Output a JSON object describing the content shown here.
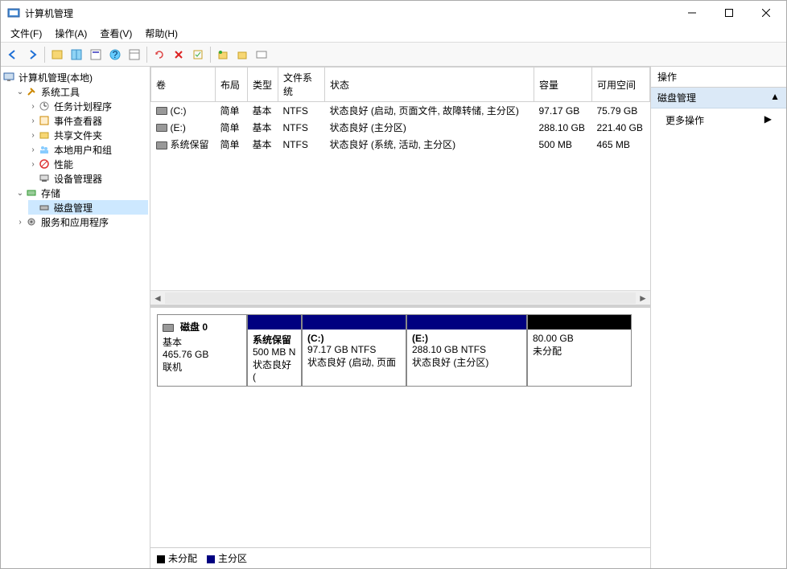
{
  "window": {
    "title": "计算机管理"
  },
  "menus": {
    "file": "文件(F)",
    "action": "操作(A)",
    "view": "查看(V)",
    "help": "帮助(H)"
  },
  "tree": {
    "root": "计算机管理(本地)",
    "system_tools": "系统工具",
    "task_scheduler": "任务计划程序",
    "event_viewer": "事件查看器",
    "shared_folders": "共享文件夹",
    "local_users": "本地用户和组",
    "performance": "性能",
    "device_manager": "设备管理器",
    "storage": "存储",
    "disk_management": "磁盘管理",
    "services": "服务和应用程序"
  },
  "volumes": {
    "headers": {
      "volume": "卷",
      "layout": "布局",
      "type": "类型",
      "fs": "文件系统",
      "status": "状态",
      "capacity": "容量",
      "free": "可用空间"
    },
    "rows": [
      {
        "name": "(C:)",
        "layout": "简单",
        "type": "基本",
        "fs": "NTFS",
        "status": "状态良好 (启动, 页面文件, 故障转储, 主分区)",
        "capacity": "97.17 GB",
        "free": "75.79 GB"
      },
      {
        "name": "(E:)",
        "layout": "简单",
        "type": "基本",
        "fs": "NTFS",
        "status": "状态良好 (主分区)",
        "capacity": "288.10 GB",
        "free": "221.40 GB"
      },
      {
        "name": "系统保留",
        "layout": "简单",
        "type": "基本",
        "fs": "NTFS",
        "status": "状态良好 (系统, 活动, 主分区)",
        "capacity": "500 MB",
        "free": "465 MB"
      }
    ]
  },
  "disk": {
    "label": "磁盘 0",
    "type_line": "基本",
    "size": "465.76 GB",
    "status": "联机",
    "partitions": [
      {
        "name": "系统保留",
        "size": "500 MB N",
        "status": "状态良好 (",
        "kind": "primary",
        "width": 68
      },
      {
        "name": "(C:)",
        "size": "97.17 GB NTFS",
        "status": "状态良好 (启动, 页面",
        "kind": "primary",
        "width": 130
      },
      {
        "name": "(E:)",
        "size": "288.10 GB NTFS",
        "status": "状态良好 (主分区)",
        "kind": "primary",
        "width": 150
      },
      {
        "name": "",
        "size": "80.00 GB",
        "status": "未分配",
        "kind": "unalloc",
        "width": 130
      }
    ]
  },
  "legend": {
    "unalloc": "未分配",
    "primary": "主分区"
  },
  "actions": {
    "header": "操作",
    "section": "磁盘管理",
    "more": "更多操作"
  }
}
